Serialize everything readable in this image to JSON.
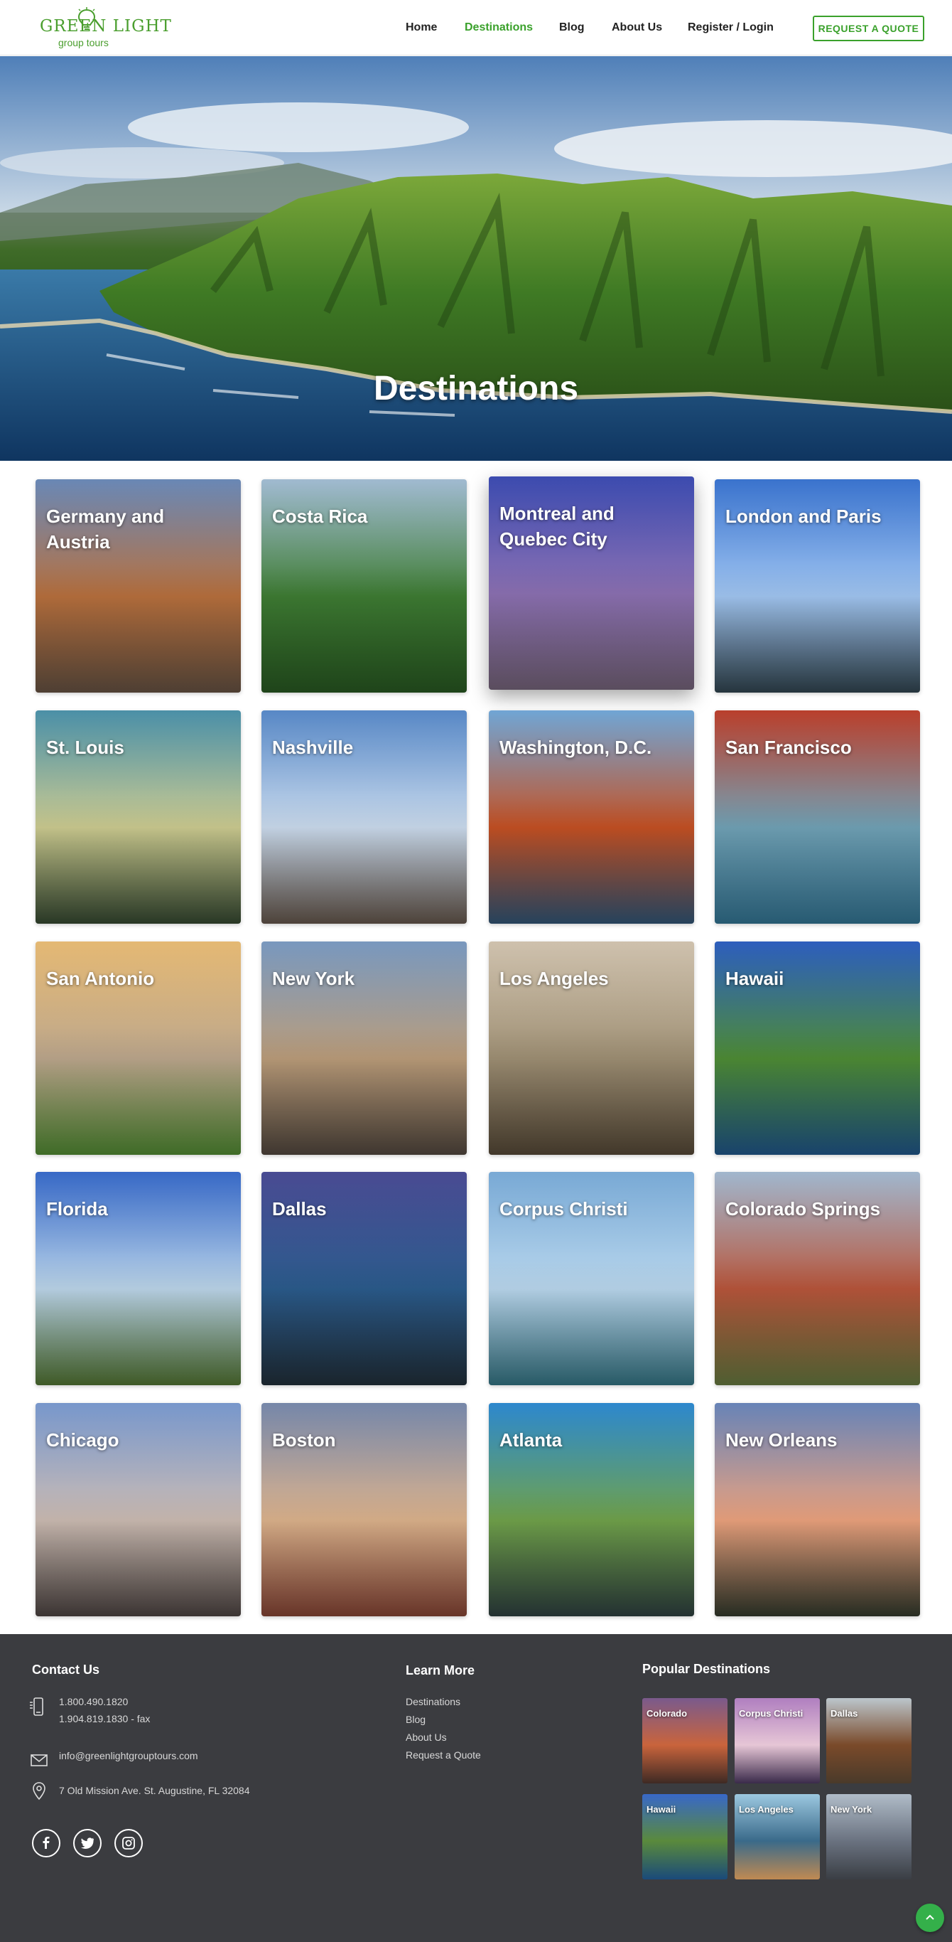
{
  "header": {
    "logo_top": "GREEN LIGHT",
    "logo_sub": "group tours",
    "nav": [
      {
        "label": "Home",
        "active": false
      },
      {
        "label": "Destinations",
        "active": true
      },
      {
        "label": "Blog",
        "active": false
      },
      {
        "label": "About Us",
        "active": false
      },
      {
        "label": "Register / Login",
        "active": false
      }
    ],
    "quote_button": "REQUEST A QUOTE"
  },
  "hero": {
    "title": "Destinations"
  },
  "destinations": [
    {
      "name": "Germany and Austria",
      "palette": [
        "#6f8fbf",
        "#b56e3c",
        "#5c4a3c"
      ]
    },
    {
      "name": "Costa Rica",
      "palette": [
        "#a9c4dc",
        "#3d7a32",
        "#24501e"
      ]
    },
    {
      "name": "Montreal and Quebec City",
      "palette": [
        "#3f4fb8",
        "#8a6fb0",
        "#6a5a6e"
      ]
    },
    {
      "name": "London and Paris",
      "palette": [
        "#3d79d8",
        "#9fc3ee",
        "#2c3e48"
      ]
    },
    {
      "name": "St. Louis",
      "palette": [
        "#4f97b0",
        "#c9c88e",
        "#30422c"
      ]
    },
    {
      "name": "Nashville",
      "palette": [
        "#5c8fd0",
        "#c8d8ea",
        "#5b4e44"
      ]
    },
    {
      "name": "Washington, D.C.",
      "palette": [
        "#76aee0",
        "#c24f22",
        "#2d4e6c"
      ]
    },
    {
      "name": "San Francisco",
      "palette": [
        "#c3422e",
        "#6fa0b4",
        "#2e6a86"
      ]
    },
    {
      "name": "San Antonio",
      "palette": [
        "#f0c27a",
        "#b9a48a",
        "#4a7e2e"
      ]
    },
    {
      "name": "New York",
      "palette": [
        "#7fa0c8",
        "#b89a78",
        "#4a4038"
      ]
    },
    {
      "name": "Los Angeles",
      "palette": [
        "#d9cbb6",
        "#9c8d72",
        "#4e4232"
      ]
    },
    {
      "name": "Hawaii",
      "palette": [
        "#2f63c7",
        "#4d8a34",
        "#1d4f7e"
      ]
    },
    {
      "name": "Florida",
      "palette": [
        "#3a6ed0",
        "#b9d2e6",
        "#4a6a2e"
      ]
    },
    {
      "name": "Dallas",
      "palette": [
        "#4d4f9a",
        "#2a5a8a",
        "#1e2a34"
      ]
    },
    {
      "name": "Corpus Christi",
      "palette": [
        "#7fb2e0",
        "#b7d4ea",
        "#2f6a78"
      ]
    },
    {
      "name": "Colorado Springs",
      "palette": [
        "#a9c0d8",
        "#b5543a",
        "#5d6e3a"
      ]
    },
    {
      "name": "Chicago",
      "palette": [
        "#7e9fd6",
        "#c9b9b0",
        "#463e3c"
      ]
    },
    {
      "name": "Boston",
      "palette": [
        "#7c8eb2",
        "#d9b08a",
        "#7a3e30"
      ]
    },
    {
      "name": "Atlanta",
      "palette": [
        "#2f8fd8",
        "#6fa04a",
        "#2a3a3a"
      ]
    },
    {
      "name": "New Orleans",
      "palette": [
        "#6d8ac0",
        "#e8a07c",
        "#2e3428"
      ]
    }
  ],
  "footer": {
    "contact_heading": "Contact Us",
    "phone": "1.800.490.1820",
    "fax": "1.904.819.1830 - fax",
    "email": "info@greenlightgrouptours.com",
    "address": "7 Old Mission Ave. St. Augustine, FL 32084",
    "learn_heading": "Learn More",
    "learn_links": [
      "Destinations",
      "Blog",
      "About Us",
      "Request a Quote"
    ],
    "popular_heading": "Popular Destinations",
    "popular": [
      {
        "name": "Colorado",
        "palette": [
          "#7a5a8c",
          "#c9643c",
          "#3e2a24"
        ]
      },
      {
        "name": "Corpus Christi",
        "palette": [
          "#b07fc0",
          "#e6c6d6",
          "#3a2a4a"
        ]
      },
      {
        "name": "Dallas",
        "palette": [
          "#bcc6cc",
          "#7a4a2a",
          "#4a3a2a"
        ]
      },
      {
        "name": "Hawaii",
        "palette": [
          "#3868c8",
          "#5a8a3c",
          "#1a4a7a"
        ]
      },
      {
        "name": "Los Angeles",
        "palette": [
          "#9cc8e0",
          "#3a6a8a",
          "#c08a52"
        ]
      },
      {
        "name": "New York",
        "palette": [
          "#b0bcc8",
          "#6a7280",
          "#3a3e44"
        ]
      }
    ]
  }
}
